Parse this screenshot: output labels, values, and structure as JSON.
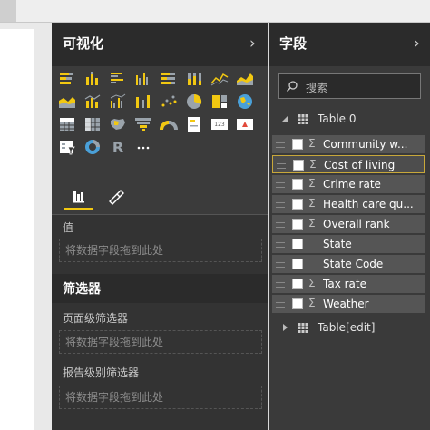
{
  "visualizations": {
    "title": "可视化",
    "icons": [
      "stacked-bar-icon",
      "stacked-column-icon",
      "clustered-bar-icon",
      "clustered-column-icon",
      "100-bar-icon",
      "100-column-icon",
      "line-chart-icon",
      "area-chart-icon",
      "stacked-area-icon",
      "line-column-icon",
      "line-clustered-icon",
      "ribbon-chart-icon",
      "scatter-icon",
      "pie-chart-icon",
      "treemap-icon",
      "globe-map-icon",
      "table-icon",
      "matrix-icon",
      "filled-map-icon",
      "funnel-icon",
      "gauge-icon",
      "card-icon",
      "multirow-card-icon",
      "kpi-icon",
      "slicer-icon",
      "donut-icon",
      "r-visual-icon",
      "more-icon"
    ],
    "values_label": "值",
    "drop_hint": "将数据字段拖到此处"
  },
  "filters": {
    "title": "筛选器",
    "page_level": "页面级筛选器",
    "page_drop": "将数据字段拖到此处",
    "report_level": "报告级别筛选器",
    "report_drop": "将数据字段拖到此处"
  },
  "fields": {
    "title": "字段",
    "search_placeholder": "搜索",
    "table0": "Table 0",
    "items": [
      {
        "label": "Community w...",
        "sigma": "Σ"
      },
      {
        "label": "Cost of living",
        "sigma": "Σ"
      },
      {
        "label": "Crime rate",
        "sigma": "Σ"
      },
      {
        "label": "Health care qu...",
        "sigma": "Σ"
      },
      {
        "label": "Overall rank",
        "sigma": "Σ"
      },
      {
        "label": "State",
        "sigma": ""
      },
      {
        "label": "State Code",
        "sigma": ""
      },
      {
        "label": "Tax rate",
        "sigma": "Σ"
      },
      {
        "label": "Weather",
        "sigma": "Σ"
      }
    ],
    "table_edit": "Table[edit]"
  },
  "colors": {
    "accent": "#f2c811",
    "pane_dark": "#2b2b2b",
    "pane_mid": "#3b3b3b"
  }
}
